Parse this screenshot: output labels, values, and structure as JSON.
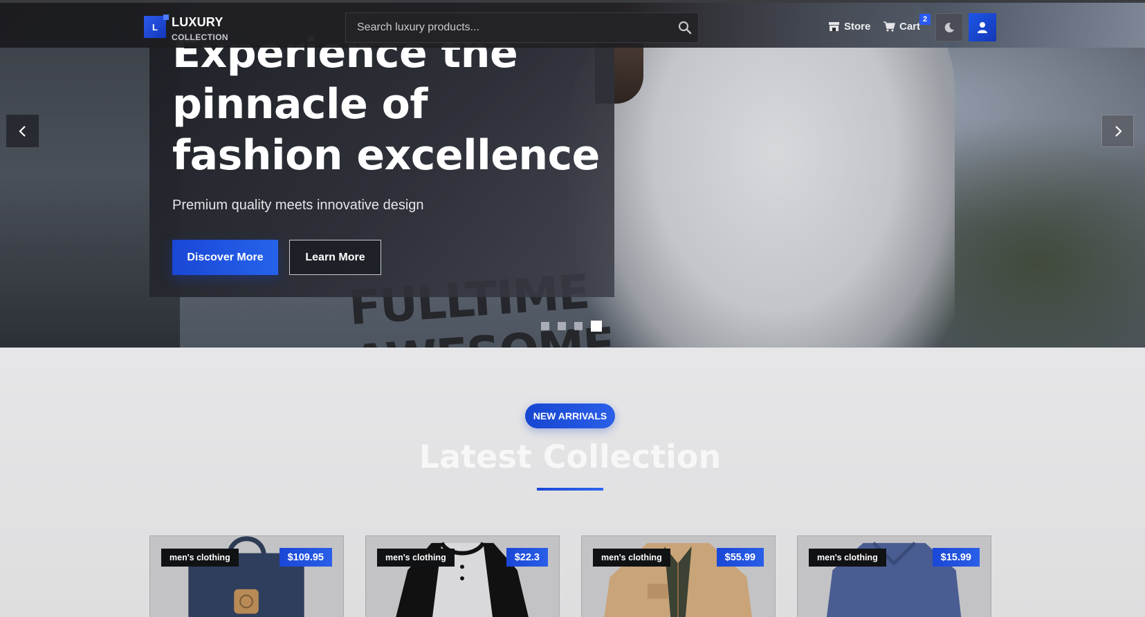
{
  "brand": {
    "logo_letter": "L",
    "title": "LUXURY",
    "subtitle": "COLLECTION"
  },
  "search": {
    "placeholder": "Search luxury products..."
  },
  "nav": {
    "store_label": "Store",
    "cart_label": "Cart",
    "cart_count": "2"
  },
  "hero": {
    "title": "Experience the pinnacle of fashion excellence",
    "subtitle": "Premium quality meets innovative design",
    "primary_button": "Discover More",
    "secondary_button": "Learn More",
    "shirt_print": "FULLTIME AWESOME",
    "slides_total": 4,
    "active_slide": 4
  },
  "section": {
    "badge": "NEW ARRIVALS",
    "title": "Latest Collection"
  },
  "products": [
    {
      "category": "men's clothing",
      "price": "$109.95",
      "image": "backpack"
    },
    {
      "category": "men's clothing",
      "price": "$22.3",
      "image": "henley-shirt"
    },
    {
      "category": "men's clothing",
      "price": "$55.99",
      "image": "cotton-jacket"
    },
    {
      "category": "men's clothing",
      "price": "$15.99",
      "image": "slim-fit-tee"
    }
  ],
  "colors": {
    "accent": "#1e55e8",
    "nav_bg": "#1a1b1f",
    "section_bg": "#e4e4e6"
  },
  "icons": [
    "store-icon",
    "cart-icon",
    "moon-icon",
    "user-icon",
    "search-icon",
    "chevron-left-icon",
    "chevron-right-icon"
  ]
}
